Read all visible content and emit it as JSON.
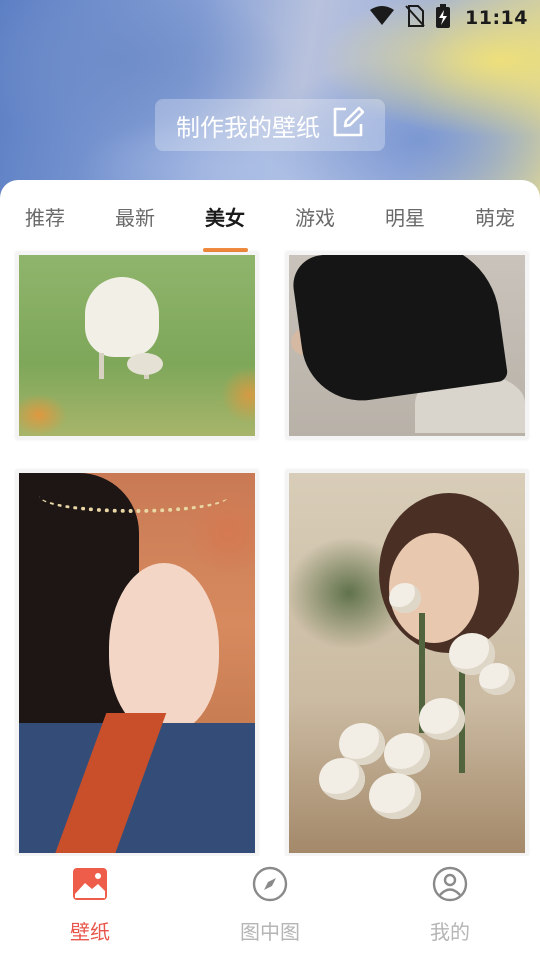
{
  "status_bar": {
    "time": "11:14"
  },
  "header": {
    "make_wallpaper_label": "制作我的壁纸"
  },
  "tabs": [
    {
      "label": "推荐"
    },
    {
      "label": "最新"
    },
    {
      "label": "美女",
      "active": true
    },
    {
      "label": "游戏"
    },
    {
      "label": "明星"
    },
    {
      "label": "萌宠"
    }
  ],
  "bottom_nav": [
    {
      "label": "壁纸",
      "icon": "image-icon",
      "active": true
    },
    {
      "label": "图中图",
      "icon": "compass-icon"
    },
    {
      "label": "我的",
      "icon": "user-icon"
    }
  ],
  "colors": {
    "accent": "#e8564c",
    "tab_indicator": "#f08a3e"
  }
}
